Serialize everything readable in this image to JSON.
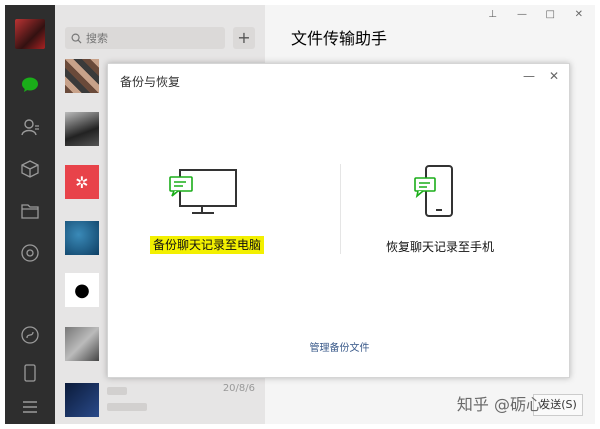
{
  "search": {
    "placeholder": "搜索"
  },
  "add_label": "+",
  "main": {
    "title": "文件传输助手",
    "send_label": "发送(S)"
  },
  "window_controls": {
    "pin": "⊥",
    "minimize": "—",
    "maximize": "□",
    "close": "✕"
  },
  "chats": [
    {
      "date": ""
    },
    {
      "date": ""
    },
    {
      "date": ""
    },
    {
      "date": ""
    },
    {
      "date": ""
    },
    {
      "date": ""
    },
    {
      "date": "20/8/6"
    }
  ],
  "dialog": {
    "title": "备份与恢复",
    "minimize": "—",
    "close": "✕",
    "backup_label": "备份聊天记录至电脑",
    "restore_label": "恢复聊天记录至手机",
    "manage_label": "管理备份文件"
  },
  "watermark": "知乎 @砺心",
  "colors": {
    "accent_green": "#1aad19",
    "highlight": "#f3f000",
    "nav_bg": "#2e2e2e"
  }
}
